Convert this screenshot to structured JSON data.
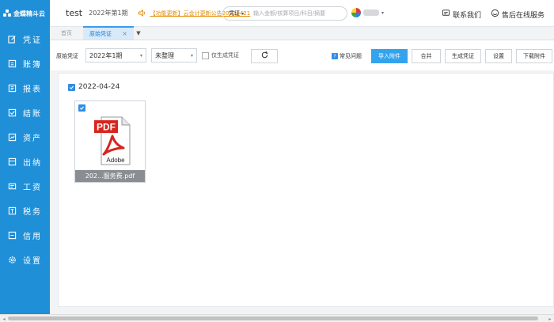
{
  "app": {
    "logo_text": "金蝶精斗云",
    "company": "test",
    "period": "2022年第1期",
    "notice_text": "【功能更新】云会计更新公告20220421"
  },
  "search": {
    "type_label": "凭证",
    "placeholder": "输入金额/核算项目/科目/摘要"
  },
  "header_actions": {
    "contact_label": "联系我们",
    "service_label": "售后在线服务"
  },
  "sidebar": {
    "items": [
      {
        "label": "凭证",
        "icon": "edit-icon"
      },
      {
        "label": "账簿",
        "icon": "book-icon"
      },
      {
        "label": "报表",
        "icon": "report-icon"
      },
      {
        "label": "结账",
        "icon": "checkout-icon"
      },
      {
        "label": "资产",
        "icon": "asset-icon"
      },
      {
        "label": "出纳",
        "icon": "cashier-icon"
      },
      {
        "label": "工资",
        "icon": "salary-icon"
      },
      {
        "label": "税务",
        "icon": "tax-icon"
      },
      {
        "label": "信用",
        "icon": "credit-icon"
      },
      {
        "label": "设置",
        "icon": "gear-icon"
      }
    ]
  },
  "tabs": {
    "home": "首页",
    "active": "原始凭证"
  },
  "toolbar": {
    "label": "原始凭证",
    "period_value": "2022年1期",
    "status_value": "未整理",
    "only_generated_label": "仅生成凭证",
    "help_label": "常见问题",
    "import_label": "导入附件",
    "merge_label": "合并",
    "generate_label": "生成凭证",
    "settings_label": "设置",
    "download_label": "下载附件"
  },
  "content": {
    "date_group": "2022-04-24",
    "files": [
      {
        "name": "202...服务费.pdf",
        "type": "PDF",
        "brand": "Adobe"
      }
    ]
  },
  "colors": {
    "sidebar": "#1f8fd8",
    "primary": "#33a3ee",
    "notice": "#e08a00",
    "pdf_red": "#d7251e"
  }
}
